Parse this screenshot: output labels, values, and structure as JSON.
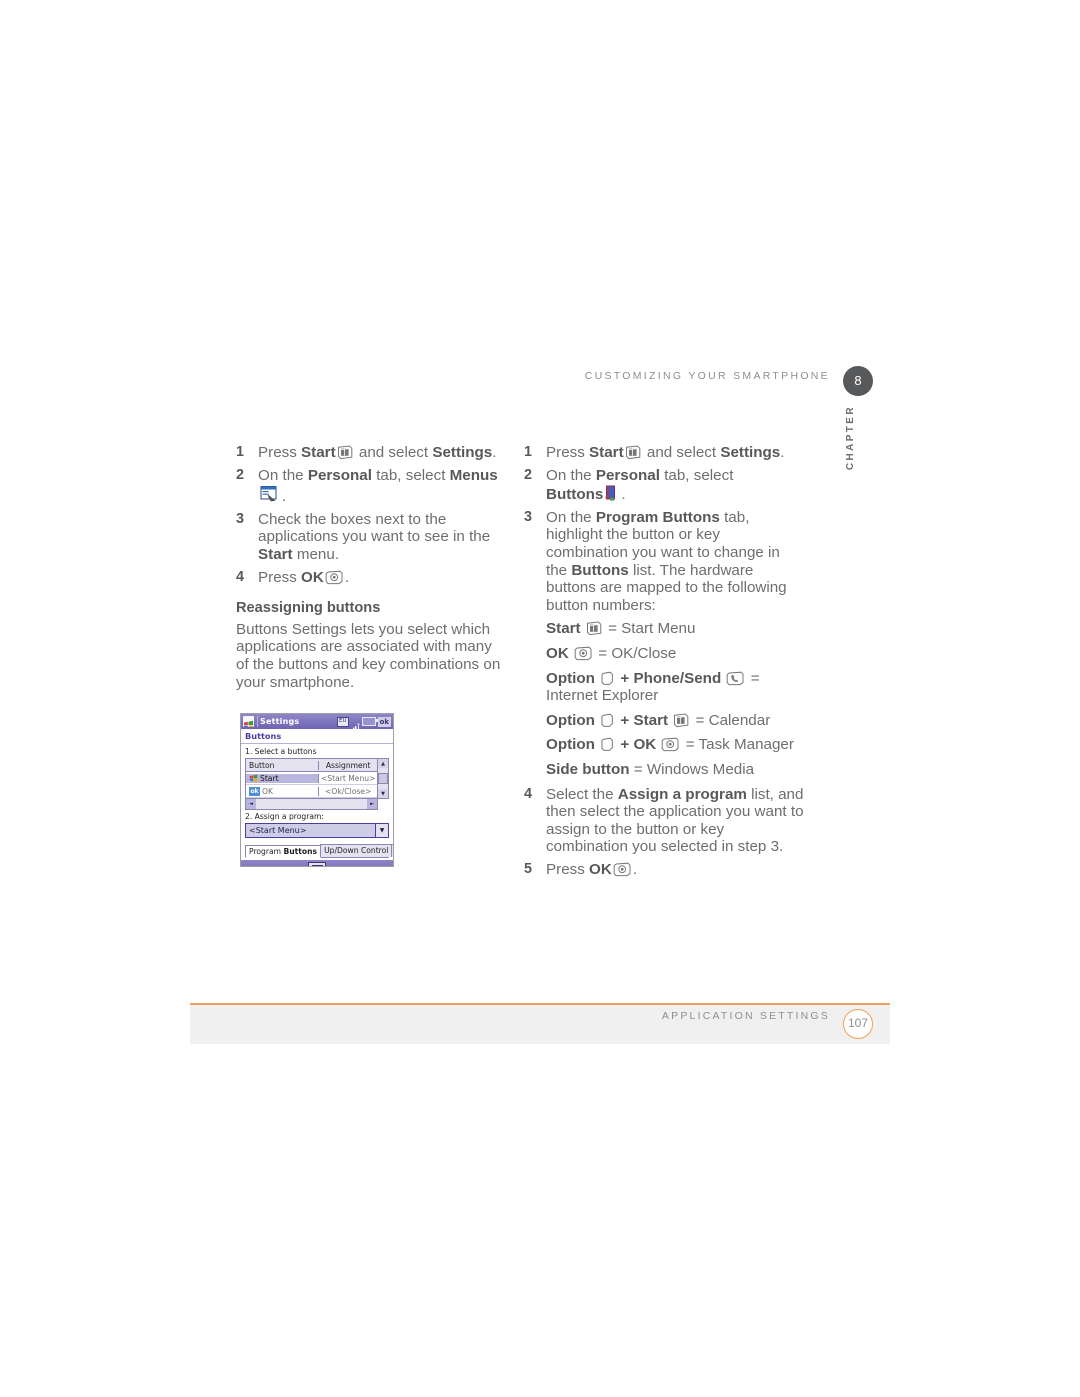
{
  "runhead": {
    "title": "CUSTOMIZING YOUR SMARTPHONE",
    "chapter_number": "8",
    "chapter_word": "CHAPTER"
  },
  "left_column": {
    "steps": [
      {
        "num": "1",
        "text_1": "Press ",
        "bold_1": "Start",
        "icon": "start-key-icon",
        "text_2": " and select ",
        "bold_2": "Settings",
        "text_3": "."
      },
      {
        "num": "2",
        "text_1": "On the ",
        "bold_1": "Personal",
        "text_2": " tab, select ",
        "bold_2": "Menus",
        "icon": "menus-app-icon",
        "text_3": "."
      },
      {
        "num": "3",
        "text_1": "Check the boxes next to the applications you want to see in the ",
        "bold_1": "Start",
        "text_2": " menu."
      },
      {
        "num": "4",
        "text_1": "Press ",
        "bold_1": "OK",
        "icon": "ok-key-icon",
        "text_2": "."
      }
    ],
    "subheading": "Reassigning buttons",
    "paragraph": "Buttons Settings lets you select which applications are associated with many of the buttons and key combinations on your smartphone."
  },
  "device_screenshot": {
    "titlebar": {
      "start_icon": "windows-start-icon",
      "title": "Settings",
      "tray": {
        "input_chip": "EU",
        "signal_icon": "signal-bars-icon",
        "battery_icon": "battery-icon",
        "ok_button": "ok"
      }
    },
    "subtitle": "Buttons",
    "label_1": "1. Select a buttons",
    "table": {
      "headers": [
        "Button",
        "Assignment"
      ],
      "rows": [
        {
          "icon": "windows-start-icon",
          "button": "Start",
          "assignment": "<Start Menu>",
          "selected": true
        },
        {
          "icon": "ok-badge-icon",
          "button": "OK",
          "assignment": "<Ok/Close>",
          "selected": false
        }
      ]
    },
    "scroll": {
      "up_arrow": "▲",
      "down_arrow": "▼",
      "left_arrow": "◄",
      "right_arrow": "►"
    },
    "label_2": "2. Assign a program:",
    "combo_value": "<Start Menu>",
    "combo_arrow": "▼",
    "tabs": [
      {
        "label_plain": "Program ",
        "label_bold": "Buttons",
        "active": true
      },
      {
        "label_plain": "Up/Down Control",
        "label_bold": "",
        "active": false
      }
    ],
    "bottombar_icon": "keyboard-icon"
  },
  "right_column": {
    "steps": [
      {
        "num": "1",
        "text_1": "Press ",
        "bold_1": "Start",
        "icon": "start-key-icon",
        "text_2": " and select ",
        "bold_2": "Settings",
        "text_3": "."
      },
      {
        "num": "2",
        "text_1": "On the ",
        "bold_1": "Personal",
        "text_2": " tab, select ",
        "bold_2": "Buttons",
        "icon": "buttons-app-icon",
        "text_3": "."
      },
      {
        "num": "3",
        "text_1": "On the ",
        "bold_1": "Program Buttons",
        "text_2": " tab, highlight the button or key combination you want to change in the ",
        "bold_2": "Buttons",
        "text_3": " list. The hardware buttons are mapped to the following button numbers:"
      }
    ],
    "mappings": [
      {
        "bold_1": "Start",
        "icon_1": "start-key-icon",
        "plus": "",
        "bold_2": "",
        "icon_2": "",
        "equals": " = ",
        "value": "Start Menu"
      },
      {
        "bold_1": "OK",
        "icon_1": "ok-key-icon",
        "plus": "",
        "bold_2": "",
        "icon_2": "",
        "equals": " = ",
        "value": "OK/Close"
      },
      {
        "bold_1": "Option",
        "icon_1": "option-key-icon",
        "plus": " + ",
        "bold_2": "Phone/Send",
        "icon_2": "phone-send-key-icon",
        "equals": " = ",
        "value": "Internet Explorer"
      },
      {
        "bold_1": "Option",
        "icon_1": "option-key-icon",
        "plus": " + ",
        "bold_2": "Start",
        "icon_2": "start-key-icon",
        "equals": " = ",
        "value": "Calendar"
      },
      {
        "bold_1": "Option",
        "icon_1": "option-key-icon",
        "plus": " + ",
        "bold_2": "OK",
        "icon_2": "ok-key-icon",
        "equals": " = ",
        "value": "Task Manager"
      },
      {
        "bold_1": "Side button",
        "icon_1": "",
        "plus": "",
        "bold_2": "",
        "icon_2": "",
        "equals": " = ",
        "value": "Windows Media"
      }
    ],
    "steps_tail": [
      {
        "num": "4",
        "text_1": "Select the ",
        "bold_1": "Assign a program",
        "text_2": " list, and then select the application you want to assign to the button or key combination you selected in step 3."
      },
      {
        "num": "5",
        "text_1": "Press ",
        "bold_1": "OK",
        "icon": "ok-key-icon",
        "text_2": "."
      }
    ]
  },
  "footer": {
    "section": "APPLICATION SETTINGS",
    "page_number": "107",
    "accent_color": "#f0a05a",
    "band_color": "#f0f0f0"
  }
}
